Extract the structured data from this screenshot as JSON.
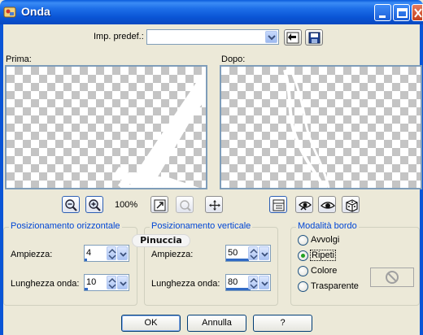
{
  "window": {
    "title": "Onda"
  },
  "preset": {
    "label": "Imp. predef.:",
    "value": ""
  },
  "previews": {
    "before_label": "Prima:",
    "after_label": "Dopo:"
  },
  "zoom": {
    "level": "100%"
  },
  "horizontal": {
    "title": "Posizionamento orizzontale",
    "amplitude_label": "Ampiezza:",
    "amplitude_value": "4",
    "wavelength_label": "Lunghezza onda:",
    "wavelength_value": "10"
  },
  "vertical": {
    "title": "Posizionamento verticale",
    "amplitude_label": "Ampiezza:",
    "amplitude_value": "50",
    "wavelength_label": "Lunghezza onda:",
    "wavelength_value": "80"
  },
  "edge_mode": {
    "title": "Modalità bordo",
    "options": [
      "Avvolgi",
      "Ripeti",
      "Colore",
      "Trasparente"
    ],
    "selected": "Ripeti"
  },
  "buttons": {
    "ok": "OK",
    "cancel": "Annulla",
    "help": "?"
  },
  "watermark": "Pinuccia",
  "colors": {
    "titlebar": "#0a55d6",
    "group_title": "#0046d5",
    "dialog_bg": "#ece9d8"
  }
}
